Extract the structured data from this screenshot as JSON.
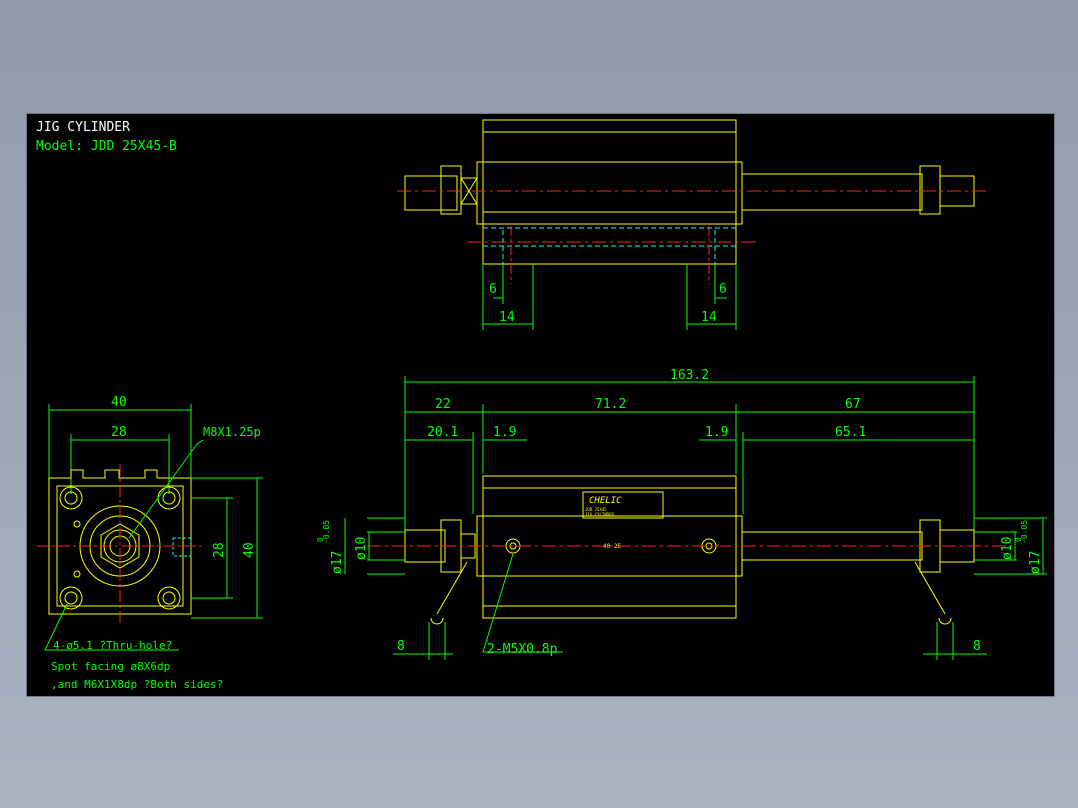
{
  "title": {
    "line1": "JIG CYLINDER",
    "line2": "Model:  JDD 25X45-B"
  },
  "colors": {
    "background": "#000000",
    "outline": "#ffff00",
    "dimension": "#00ff00",
    "centerline": "#ff2020",
    "hidden": "#00ffff",
    "text": "#ffffff"
  },
  "top_view": {
    "dims": [
      "6",
      "14",
      "6",
      "14"
    ]
  },
  "side_view": {
    "dims_top": [
      "163.2",
      "22",
      "71.2",
      "67",
      "20.1",
      "1.9",
      "1.9",
      "65.1"
    ],
    "dia_left": "ø10",
    "dia_left_outer": "ø17",
    "tol_upper": "0",
    "tol_lower": "-0.05",
    "dia_right": "ø10",
    "dia_right_outer": "ø17",
    "bottom_dims": [
      "8",
      "8"
    ],
    "port_callout": "2-M5X0.8p",
    "brand": "CHELIC",
    "plate_line1": "JDD 25X45",
    "plate_line2": "JIG CYLINDER",
    "center_text": "40 25"
  },
  "end_view": {
    "dims": [
      "40",
      "28",
      "28",
      "40"
    ],
    "thread_callout": "M8X1.25p",
    "hole_note1": "4-ø5.1 ?Thru-hole?",
    "hole_note2": "Spot facing  ø8X6dp",
    "hole_note3": ",and M6X1X8dp ?Both sides?"
  }
}
